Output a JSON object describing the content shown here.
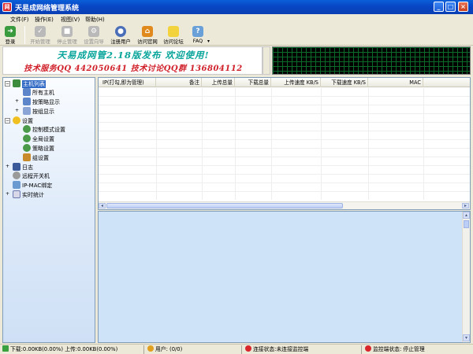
{
  "window": {
    "title": "天易成网络管理系统"
  },
  "menu": [
    "文件(F)",
    "操作(E)",
    "视图(V)",
    "帮助(H)"
  ],
  "toolbar": [
    {
      "label": "登录",
      "icon": "login-icon",
      "enabled": true
    },
    {
      "label": "开始管理",
      "icon": "start-manage-icon",
      "enabled": false
    },
    {
      "label": "停止管理",
      "icon": "stop-manage-icon",
      "enabled": false
    },
    {
      "label": "设置向导",
      "icon": "wizard-icon",
      "enabled": false
    },
    {
      "label": "注册用户",
      "icon": "register-user-icon",
      "enabled": true
    },
    {
      "label": "访问官网",
      "icon": "home-icon",
      "enabled": true
    },
    {
      "label": "访问论坛",
      "icon": "forum-icon",
      "enabled": true
    },
    {
      "label": "FAQ",
      "icon": "faq-icon",
      "enabled": true
    }
  ],
  "banner": {
    "line1": "天易成网管2.18版发布 欢迎使用!",
    "line2": "技术服务QQ 442050641 技术讨论QQ群 136804112"
  },
  "tree": [
    {
      "label": "主机列表",
      "selected": true
    },
    {
      "label": "所有主机"
    },
    {
      "label": "按策略显示"
    },
    {
      "label": "按组显示"
    },
    {
      "label": "设置"
    },
    {
      "label": "控制模式设置"
    },
    {
      "label": "全局设置"
    },
    {
      "label": "策略设置"
    },
    {
      "label": "组设置"
    },
    {
      "label": "日志"
    },
    {
      "label": "远程开关机"
    },
    {
      "label": "IP-MAC绑定"
    },
    {
      "label": "实时统计"
    }
  ],
  "list": {
    "columns": [
      "IP(打勾,即为管理)",
      "备注",
      "上传总量",
      "下载总量",
      "上传速度 KB/S",
      "下载速度 KB/S",
      "MAC"
    ]
  },
  "status": {
    "traffic": "下载:0.00KB(0.00%) 上传:0.00KB(0.00%)",
    "users": "用户: (0/0)",
    "connection": "连接状态:未连接监控端",
    "monitor": "监控端状态: 停止管理"
  },
  "colors": {
    "banner_line1": "#0aa59b",
    "banner_line2": "#d0202a",
    "selection": "#316ac5"
  }
}
